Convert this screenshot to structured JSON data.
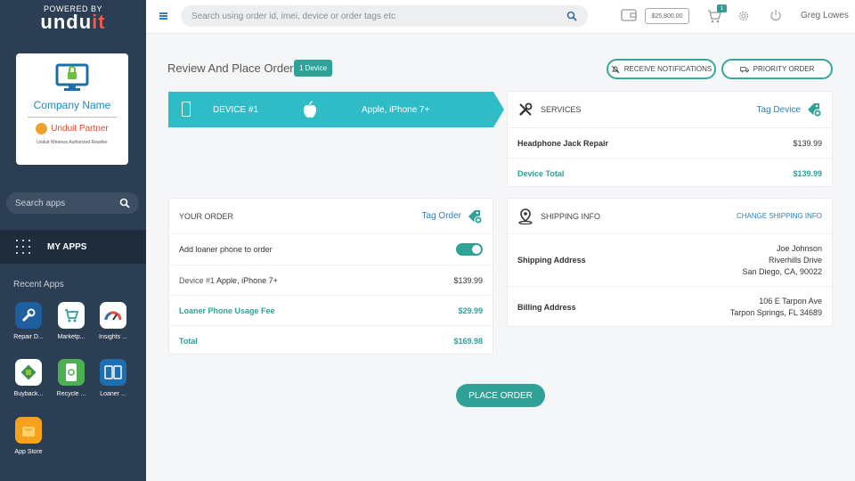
{
  "sidebar": {
    "powered_by": "POWERED BY",
    "logo_main": "undu",
    "logo_accent": "it",
    "company_name": "Company Name",
    "partner": "Unduit Partner",
    "reseller": "Unduit Wireless Authorized Reseller",
    "search_placeholder": "Search apps",
    "my_apps": "MY APPS",
    "recent_title": "Recent Apps",
    "apps": [
      {
        "name": "Repair D...",
        "icon": "wrench-icon",
        "color": "#1f5f9e"
      },
      {
        "name": "Marketp...",
        "icon": "cart-icon",
        "color": "#ffffff"
      },
      {
        "name": "Insights ...",
        "icon": "gauge-icon",
        "color": "#ffffff"
      },
      {
        "name": "Buyback...",
        "icon": "buyback-icon",
        "color": "#3f8f4f"
      },
      {
        "name": "Recycle ...",
        "icon": "recycle-icon",
        "color": "#4caf50"
      },
      {
        "name": "Loaner ...",
        "icon": "loaner-icon",
        "color": "#1d6fb0"
      },
      {
        "name": "App Store",
        "icon": "bag-icon",
        "color": "#f7a21b"
      }
    ]
  },
  "topbar": {
    "search_placeholder": "Search using order id, imei, device or order tags etc",
    "balance": "$25,800.00",
    "cart_count": "1",
    "username": "Greg Lowes"
  },
  "main": {
    "title": "Review And Place Order",
    "device_count": "1 Device",
    "receive_notifications": "RECEIVE NOTIFICATIONS",
    "priority_order": "PRIORITY ORDER",
    "device_banner": {
      "label": "DEVICE #1",
      "model": "Apple, iPhone 7+"
    },
    "services": {
      "header": "SERVICES",
      "tag_device": "Tag Device",
      "item_name": "Headphone Jack Repair",
      "item_price": "$139.99",
      "total_label": "Device Total",
      "total_value": "$139.99"
    },
    "your_order": {
      "header": "YOUR ORDER",
      "tag_order": "Tag Order",
      "loaner_toggle_label": "Add loaner phone to order",
      "device_prefix": "Device #1",
      "device_name": "Apple, iPhone 7+",
      "device_price": "$139.99",
      "loaner_fee_label": "Loaner Phone Usage Fee",
      "loaner_fee_value": "$29.99",
      "total_label": "Total",
      "total_value": "$169.98"
    },
    "shipping": {
      "header": "SHIPPING INFO",
      "change": "CHANGE SHIPPING INFO",
      "shipping_label": "Shipping Address",
      "ship_line1": "Joe Johnson",
      "ship_line2": "Riverhills Drive",
      "ship_line3": "San Diego, CA, 90022",
      "billing_label": "Billing Address",
      "bill_line1": "106 E Tarpon Ave",
      "bill_line2": "Tarpon Springs, FL 34689"
    },
    "place_order": "PLACE ORDER"
  }
}
